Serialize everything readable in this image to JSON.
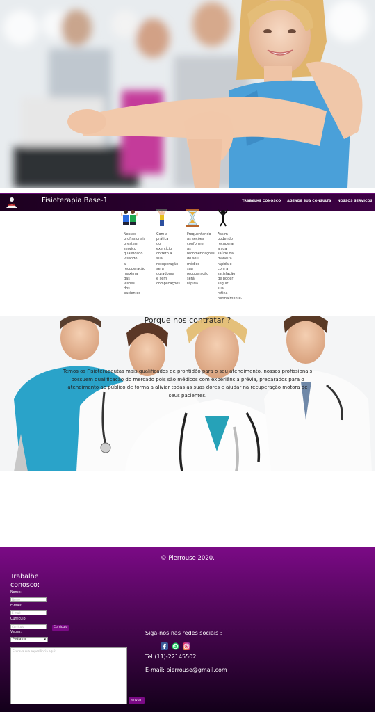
{
  "hero": {
    "alt": "hero-fitness-photo"
  },
  "navbar": {
    "brand": "Fisioterapia Base-1",
    "links": [
      "TRABALHE CONOSCO",
      "AGENDE SUA CONSULTA",
      "NOSSOS SERVIÇOS"
    ]
  },
  "features": [
    {
      "icon": "team-icon",
      "text": "Nossos\nprofissionais\nprestem\nserviço\nqualificado\nvisando\na\nrecuperação\nmaxima\ndas\nlesões\ndos\npacientes"
    },
    {
      "icon": "exercise-icon",
      "text": "Com a\nprática\ndo\nexercício\ncorreto a\nsua\nrecuperação\nserá\nduradoura\ne sem\ncomplicações."
    },
    {
      "icon": "hourglass-icon",
      "text": "Frequentando\nas seções\nconforme\nas\nrecomendações\ndo seu\nmédico\nsua\nrecuperação\nserá\nrápida."
    },
    {
      "icon": "victory-icon",
      "text": "Assim\npodendo\nrecuperar\na sua\nsaúde da\nmaneira\nrápida e\ncom a\nsatisfação\nde poder\nseguir\nsua\nrotina\nnormalmente."
    }
  ],
  "why": {
    "title": "Porque nos contratar ?",
    "text": "Temos os Fisioterapeutas mais qualificados de prontidão para o seu atendimento, nossos profissionais possuem qualificação do mercado pois são médicos com experiência prévia, preparados para o atendimento ao público de forma a aliviar todas as suas dores e ajudar na recuperação motora de seus pacientes."
  },
  "footer": {
    "copyright": "© Pierrouse 2020.",
    "form": {
      "title": "Trabalhe conosco:",
      "name_label": "Nome:",
      "name_placeholder": "Nome",
      "email_label": "E-mail:",
      "email_placeholder": "E-mail",
      "cv_label": "Curriculo:",
      "cv_placeholder": "Curriculo",
      "cv_button": "Curriculo",
      "vagas_label": "Vagas:",
      "vagas_selected": "Pediatra",
      "message_placeholder": "Escreva sua experiência aqui:",
      "send_button": "enviar"
    },
    "social_title": "Siga-nos nas redes sociais :",
    "social_icons": [
      "facebook-icon",
      "whatsapp-icon",
      "instagram-icon"
    ],
    "tel": "Tel:(11)-22145502",
    "email": "E-mail: pierrouse@gmail.com"
  },
  "colors": {
    "accent": "#7b0a86",
    "navbar": "#2a002e",
    "footer_dark": "#13001a"
  }
}
